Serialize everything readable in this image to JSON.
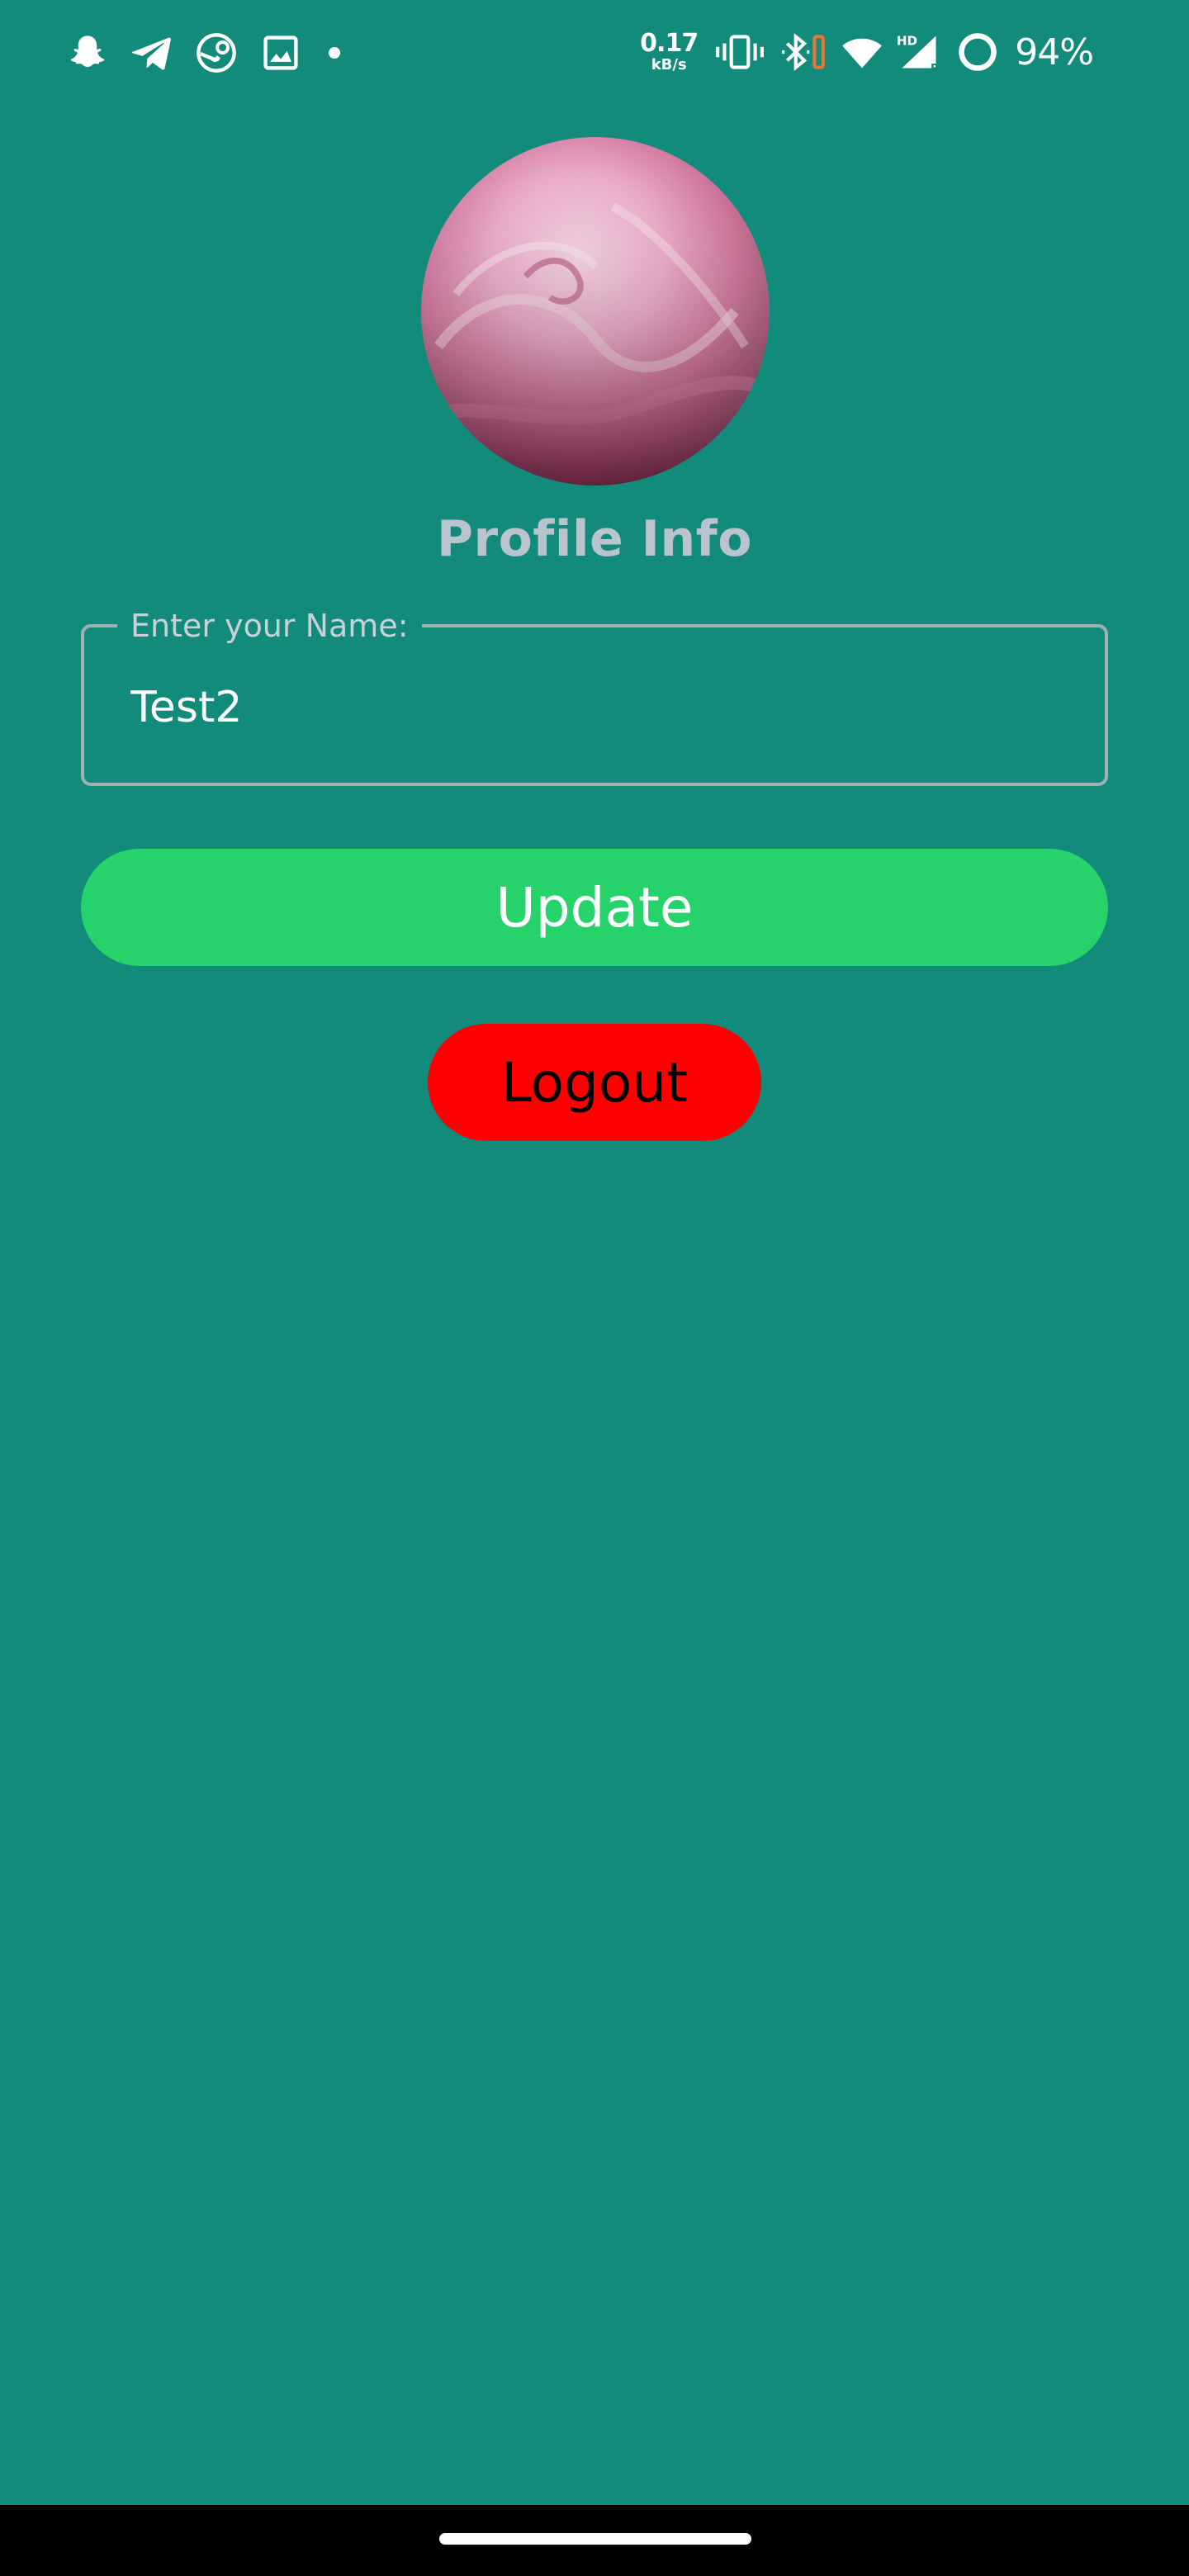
{
  "status_bar": {
    "left_icons": [
      "snapchat-icon",
      "telegram-icon",
      "steam-icon",
      "gallery-icon"
    ],
    "net_speed_value": "0.17",
    "net_speed_unit": "kB/s",
    "right_icons": [
      "vibrate-icon",
      "bluetooth-icon",
      "wifi-icon",
      "cell-signal-icon",
      "battery-ring-icon"
    ],
    "signal_badge": "HD",
    "roaming_badge": "R",
    "battery_percent": "94%",
    "battery_level": 0.94
  },
  "profile": {
    "avatar_icon": "profile-photo",
    "title": "Profile Info",
    "name_field": {
      "label": "Enter your Name:",
      "value": "Test2"
    },
    "update_label": "Update",
    "logout_label": "Logout"
  },
  "colors": {
    "background": "#138b7b",
    "update_button": "#26d36b",
    "logout_button": "#ff0000",
    "title_text": "#b9c4cc",
    "field_border": "#9fb2b3"
  },
  "nav_bar": {
    "home_indicator": "home-indicator"
  }
}
